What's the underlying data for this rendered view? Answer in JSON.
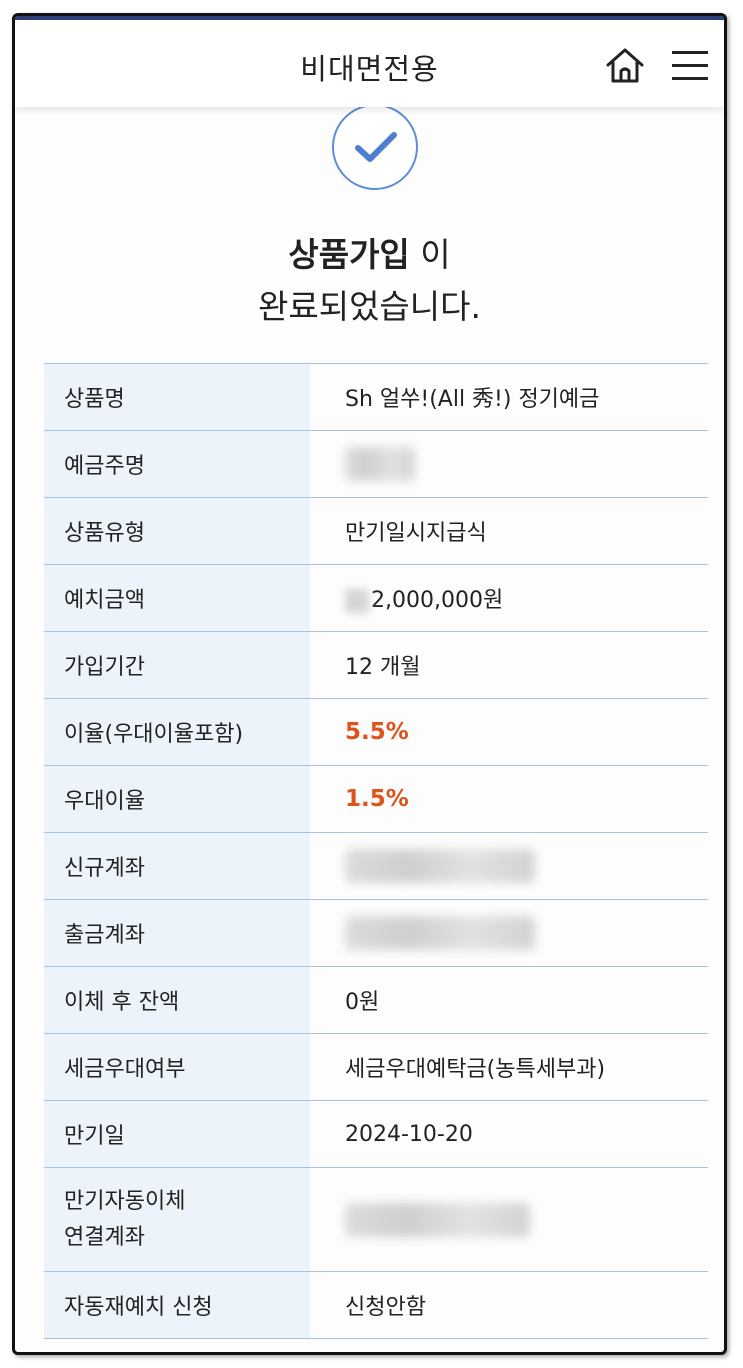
{
  "header": {
    "title": "비대면전용",
    "home_icon": "home-icon",
    "menu_icon": "hamburger-menu-icon"
  },
  "success": {
    "icon": "check-circle-icon",
    "title_bold": "상품가입",
    "title_rest": " 이",
    "subtitle": "완료되었습니다."
  },
  "colors": {
    "accent_blue": "#5f8ed6",
    "rate_orange": "#e0521b",
    "label_bg": "#edf3fa"
  },
  "rows": [
    {
      "label": "상품명",
      "value": "Sh 얼쑤!(All 秀!) 정기예금"
    },
    {
      "label": "예금주명",
      "value": ""
    },
    {
      "label": "상품유형",
      "value": "만기일시지급식"
    },
    {
      "label": "예치금액",
      "value": "2,000,000원"
    },
    {
      "label": "가입기간",
      "value": "12 개월"
    },
    {
      "label": "이율(우대이율포함)",
      "value": "5.5%"
    },
    {
      "label": "우대이율",
      "value": "1.5%"
    },
    {
      "label": "신규계좌",
      "value": ""
    },
    {
      "label": "출금계좌",
      "value": ""
    },
    {
      "label": "이체 후 잔액",
      "value": "0원"
    },
    {
      "label": "세금우대여부",
      "value": "세금우대예탁금(농특세부과)"
    },
    {
      "label": "만기일",
      "value": "2024-10-20"
    },
    {
      "label_line1": "만기자동이체",
      "label_line2": "연결계좌",
      "value": ""
    },
    {
      "label": "자동재예치 신청",
      "value": "신청안함"
    }
  ]
}
